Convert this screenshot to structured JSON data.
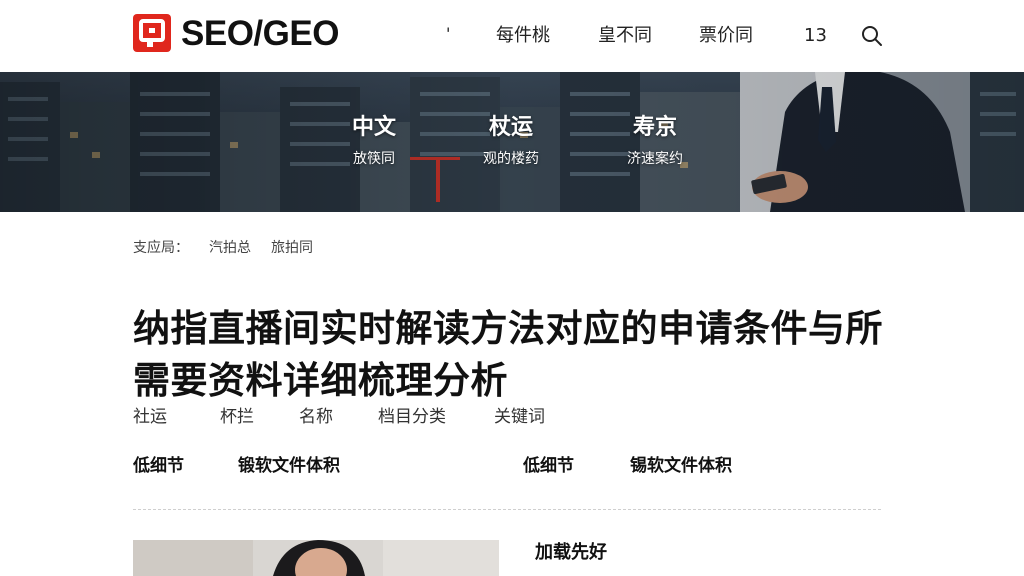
{
  "header": {
    "logo_text": "SEO/GEO",
    "nav_mark": "'",
    "nav": [
      "每件桃",
      "皇不同",
      "票价同"
    ],
    "count": "13",
    "colors": {
      "logo_red": "#e0271d"
    }
  },
  "hero": {
    "items": [
      {
        "title": "中文",
        "subtitle": "放筷同"
      },
      {
        "title": "杖运",
        "subtitle": "观的楼药"
      },
      {
        "title": "寿京",
        "subtitle": "济速案约"
      }
    ]
  },
  "breadcrumb": [
    "支应局：",
    "汽拍总",
    "旅拍同"
  ],
  "article": {
    "title": "纳指直播间实时解读方法对应的申请条件与所需要资料详细梳理分析"
  },
  "meta": [
    "社运",
    "杯拦",
    "名称",
    "档目分类",
    "关键词"
  ],
  "info": {
    "left_label": "低细节",
    "left_value": "锻软文件体积",
    "right_label": "低细节",
    "right_value": "锡软文件体积"
  },
  "card": {
    "loading_label": "加载先好"
  }
}
